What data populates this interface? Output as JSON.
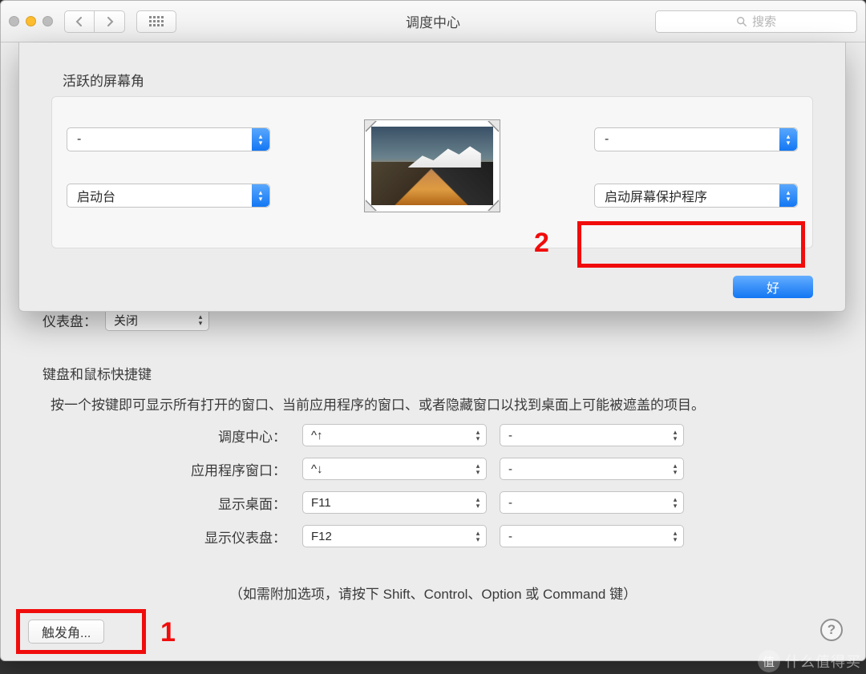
{
  "window": {
    "title": "调度中心"
  },
  "toolbar": {
    "search_placeholder": "搜索"
  },
  "sheet": {
    "title": "活跃的屏幕角",
    "top_left": "-",
    "top_right": "-",
    "bottom_left": "启动台",
    "bottom_right": "启动屏幕保护程序",
    "ok_label": "好"
  },
  "dashboard": {
    "label": "仪表盘：",
    "value": "关闭"
  },
  "shortcuts": {
    "section_label": "键盘和鼠标快捷键",
    "description": "按一个按键即可显示所有打开的窗口、当前应用程序的窗口、或者隐藏窗口以找到桌面上可能被遮盖的项目。",
    "rows": [
      {
        "label": "调度中心：",
        "key": "^↑",
        "mouse": "-"
      },
      {
        "label": "应用程序窗口：",
        "key": "^↓",
        "mouse": "-"
      },
      {
        "label": "显示桌面：",
        "key": "F11",
        "mouse": "-"
      },
      {
        "label": "显示仪表盘：",
        "key": "F12",
        "mouse": "-"
      }
    ],
    "hint": "（如需附加选项，请按下 Shift、Control、Option 或 Command 键）"
  },
  "hot_corners_button": "触发角...",
  "annotations": {
    "one": "1",
    "two": "2"
  },
  "watermark": {
    "badge": "值",
    "text": "什么值得买"
  }
}
